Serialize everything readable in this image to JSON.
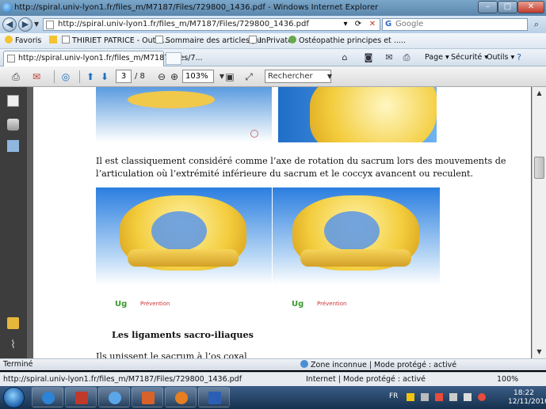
{
  "window": {
    "title": "http://spiral.univ-lyon1.fr/files_m/M7187/Files/729800_1436.pdf - Windows Internet Explorer"
  },
  "address": {
    "url": "http://spiral.univ-lyon1.fr/files_m/M7187/Files/729800_1436.pdf",
    "search_placeholder": "Google"
  },
  "favorites": {
    "label": "Favoris",
    "items": [
      "THIRIET PATRICE - Outlo...",
      "Sommaire des articles pu...",
      "InPrivate",
      "Ostéopathie principes et ....."
    ]
  },
  "tabs": [
    {
      "label": "http://spiral.univ-lyon1.fr/files_m/M7187/Files/7..."
    }
  ],
  "commands": {
    "page": "Page",
    "security": "Sécurité",
    "tools": "Outils"
  },
  "pdf_toolbar": {
    "page_current": "3",
    "page_total": "/ 8",
    "zoom": "103%",
    "find_placeholder": "Rechercher"
  },
  "document": {
    "paragraph": "Il est classiquement considéré comme l’axe de rotation du sacrum lors des mouvements de l’articulation où l’extrémité inférieure du sacrum et le coccyx avancent ou reculent.",
    "heading": "Les ligaments sacro-iliaques",
    "paragraph2": "Ils unissent le sacrum à l’os coxal",
    "logo_left": "Ug",
    "logo_right": "Ug",
    "logo_caption": "Prévention"
  },
  "status": {
    "left": "Terminé",
    "zone": "Zone inconnue | Mode protégé : activé",
    "zoom": ""
  },
  "status2": {
    "url": "http://spiral.univ-lyon1.fr/files_m/M7187/Files/729800_1436.pdf",
    "zone": "Internet | Mode protégé : activé",
    "zoom": "100%"
  },
  "taskbar": {
    "lang": "FR",
    "time": "18:22",
    "date": "12/11/2010"
  },
  "colors": {
    "accent": "#1c6fc4",
    "bone": "#f3cd3d",
    "sky": "#2b7ee0"
  }
}
